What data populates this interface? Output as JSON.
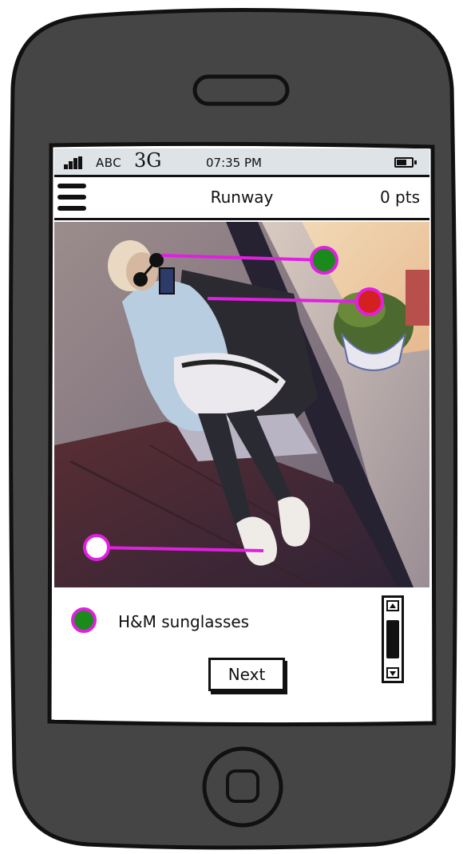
{
  "status_bar": {
    "carrier": "ABC",
    "network": "3G",
    "time": "07:35 PM",
    "battery_icon": "battery-icon",
    "signal_icon": "signal-bars-icon"
  },
  "nav_bar": {
    "menu_icon": "hamburger-menu-icon",
    "title": "Runway",
    "points": "0 pts"
  },
  "photo": {
    "description_icon": "outfit-photo",
    "tags": [
      {
        "name": "green-tag",
        "color": "#1a8a1a"
      },
      {
        "name": "red-tag",
        "color": "#d42020"
      },
      {
        "name": "white-tag",
        "color": "#ffffff"
      }
    ],
    "tag_outline_color": "#e020e0"
  },
  "selected_item": {
    "label": "H&M sunglasses",
    "dot_color": "#1a8a1a",
    "outline_color": "#e020e0"
  },
  "next_button": {
    "label": "Next"
  },
  "colors": {
    "phone_body": "#454545",
    "status_bar_bg": "#dde3e6",
    "tag_line": "#e020e0"
  }
}
